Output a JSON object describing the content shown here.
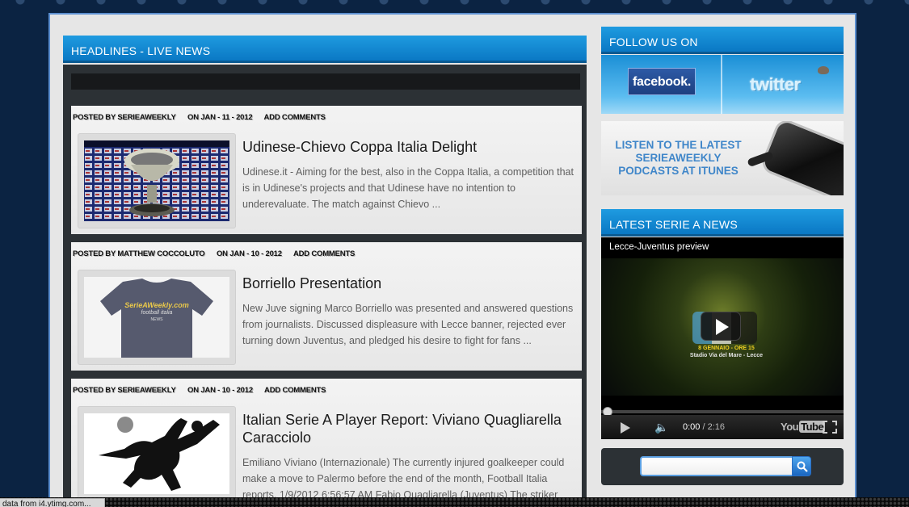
{
  "headlines": {
    "title": "HEADLINES - LIVE NEWS"
  },
  "articles": [
    {
      "posted_by": "POSTED BY SERIEAWEEKLY",
      "date": "ON JAN - 11 - 2012",
      "comments": "ADD COMMENTS",
      "title": "Udinese-Chievo Coppa Italia Delight",
      "excerpt": "Udinese.it - Aiming for the best, also in the Coppa Italia, a competition that is in Udinese's projects and that Udinese have no intention to underevaluate. The match against Chievo ..."
    },
    {
      "posted_by": "POSTED BY MATTHEW COCCOLUTO",
      "date": "ON JAN - 10 - 2012",
      "comments": "ADD COMMENTS",
      "title": "Borriello Presentation",
      "excerpt": "New Juve signing Marco Borriello was presented and answered questions from journalists. Discussed displeasure with Lecce banner, rejected ever turning down Juventus, and pledged his desire to fight for fans ...",
      "thumb_text_1": "SerieAWeekly.com",
      "thumb_text_2": "football italia",
      "thumb_text_3": "NEWS"
    },
    {
      "posted_by": "POSTED BY SERIEAWEEKLY",
      "date": "ON JAN - 10 - 2012",
      "comments": "ADD COMMENTS",
      "title": "Italian Serie A Player Report: Viviano Quagliarella Caracciolo",
      "excerpt": "Emiliano Viviano (Internazionale) The currently injured goalkeeper could make a move to Palermo before the end of the month, Football Italia reports. 1/9/2012 6:56:57 AM Fabio Quagliarella (Juventus) The striker"
    }
  ],
  "follow": {
    "title": "FOLLOW US ON",
    "facebook": "facebook.",
    "twitter": "twitter"
  },
  "podcast": {
    "text": "LISTEN TO THE LATEST SERIEAWEEKLY PODCASTS AT ITUNES"
  },
  "latest_news": {
    "title": "LATEST SERIE A NEWS"
  },
  "video": {
    "title": "Lecce-Juventus preview",
    "promo_line1": "8 GENNAIO - ORE 15",
    "promo_line2": "Stadio Via del Mare - Lecce",
    "current_time": "0:00",
    "separator": " / ",
    "duration": "2:16",
    "brand_you": "You",
    "brand_tube": "Tube"
  },
  "search": {
    "placeholder": ""
  },
  "status": {
    "text": "data from i4.ytimg.com..."
  },
  "colors": {
    "header_blue": "#0a78c4",
    "podcast_blue": "#3f86c9",
    "page_bg": "#0b2342",
    "panel_dark": "#2c3135"
  }
}
